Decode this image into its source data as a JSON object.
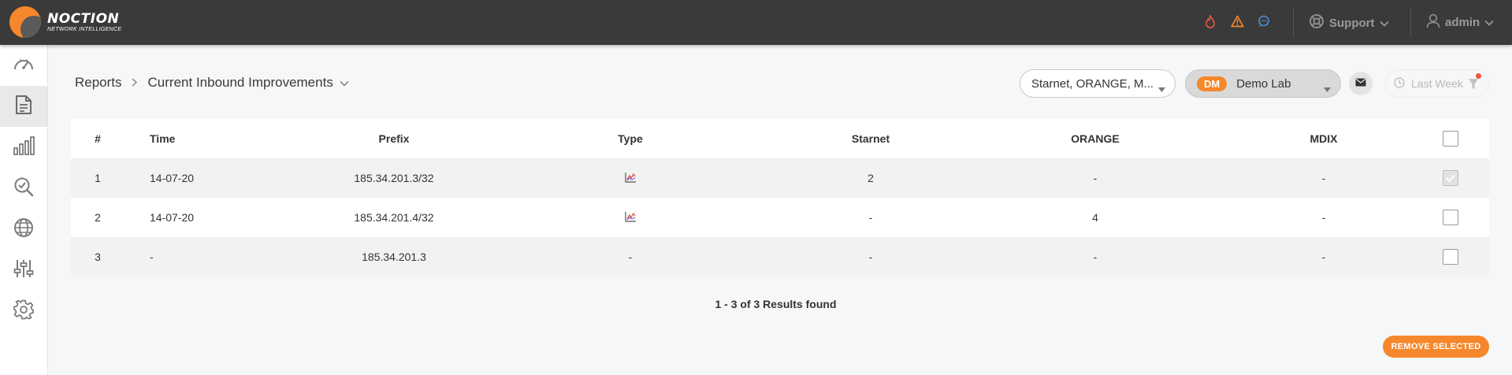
{
  "app": {
    "logo_name": "NOCTION",
    "logo_sub": "NETWORK INTELLIGENCE"
  },
  "header": {
    "alerts": [
      {
        "icon": "flame-icon",
        "color": "#f0573a"
      },
      {
        "icon": "warning-icon",
        "color": "#f5872c"
      },
      {
        "icon": "chat-icon",
        "color": "#4b8fd6"
      }
    ],
    "support_label": "Support",
    "user_label": "admin"
  },
  "sidebar": {
    "items": [
      {
        "name": "dashboard",
        "icon": "speedometer-icon",
        "active": false
      },
      {
        "name": "reports",
        "icon": "document-icon",
        "active": true
      },
      {
        "name": "graphs",
        "icon": "bar-chart-icon",
        "active": false
      },
      {
        "name": "analysis",
        "icon": "search-check-icon",
        "active": false
      },
      {
        "name": "network",
        "icon": "globe-icon",
        "active": false
      },
      {
        "name": "configuration",
        "icon": "sliders-icon",
        "active": false
      },
      {
        "name": "settings",
        "icon": "gear-icon",
        "active": false
      }
    ]
  },
  "toolbar": {
    "breadcrumb_root": "Reports",
    "breadcrumb_current": "Current Inbound Improvements",
    "providers_filter": "Starnet, ORANGE, M...",
    "lab_badge": "DM",
    "lab_name": "Demo Lab",
    "period": "Last Week"
  },
  "table": {
    "columns": [
      "#",
      "Time",
      "Prefix",
      "Type",
      "Starnet",
      "ORANGE",
      "MDIX"
    ],
    "rows": [
      {
        "num": "1",
        "time": "14-07-20",
        "prefix": "185.34.201.3/32",
        "type": "chart",
        "starnet": "2",
        "orange": "-",
        "mdix": "-",
        "checked": true
      },
      {
        "num": "2",
        "time": "14-07-20",
        "prefix": "185.34.201.4/32",
        "type": "chart",
        "starnet": "-",
        "orange": "4",
        "mdix": "-",
        "checked": false
      },
      {
        "num": "3",
        "time": "-",
        "prefix": "185.34.201.3",
        "type": "-",
        "starnet": "-",
        "orange": "-",
        "mdix": "-",
        "checked": false
      }
    ]
  },
  "results_text": "1 - 3 of 3 Results found",
  "remove_button": "REMOVE SELECTED",
  "colors": {
    "accent": "#f5872c",
    "topbar": "#3a3a3a"
  }
}
